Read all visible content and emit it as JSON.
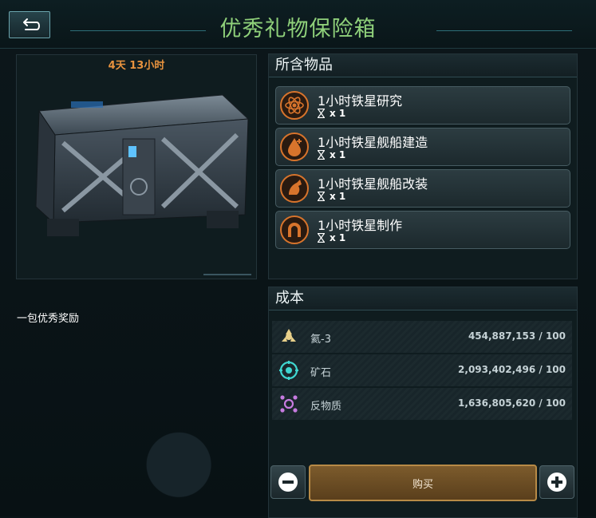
{
  "header": {
    "title": "优秀礼物保险箱",
    "back_icon": "back-arrow-icon"
  },
  "left": {
    "timer": "4天 13小时",
    "description": "一包优秀奖励"
  },
  "items_panel": {
    "title": "所含物品",
    "items": [
      {
        "name": "1小时铁星研究",
        "qty": "x 1",
        "icon": "research-atom-icon"
      },
      {
        "name": "1小时铁星舰船建造",
        "qty": "x 1",
        "icon": "ship-build-icon"
      },
      {
        "name": "1小时铁星舰船改装",
        "qty": "x 1",
        "icon": "ship-refit-icon"
      },
      {
        "name": "1小时铁星制作",
        "qty": "x 1",
        "icon": "crafting-icon"
      }
    ]
  },
  "cost_panel": {
    "title": "成本",
    "rows": [
      {
        "label": "氦-3",
        "value": "454,887,153 / 100",
        "icon": "helium3-icon",
        "color": "#e8d08a"
      },
      {
        "label": "矿石",
        "value": "2,093,402,496 / 100",
        "icon": "ore-icon",
        "color": "#3fd6d0"
      },
      {
        "label": "反物质",
        "value": "1,636,805,620 / 100",
        "icon": "antimatter-icon",
        "color": "#c77be0"
      }
    ]
  },
  "actions": {
    "buy_label": "购买",
    "minus_icon": "minus-icon",
    "plus_icon": "plus-icon"
  },
  "colors": {
    "title_green": "#8fd07a",
    "timer_orange": "#e8933e",
    "item_icon_orange": "#d8742c",
    "buy_gold": "#b78a46"
  }
}
